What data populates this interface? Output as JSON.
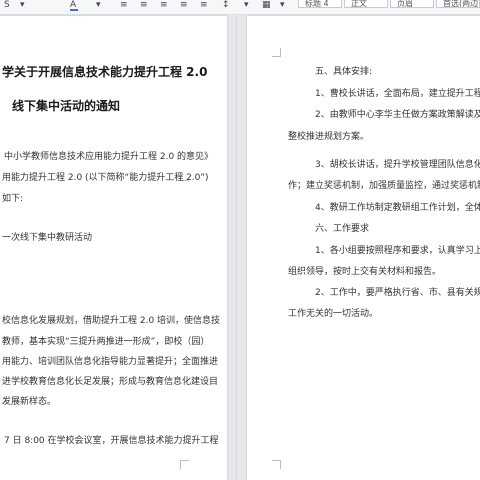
{
  "toolbar": {
    "style_box_1": "标题 4",
    "style_box_2": "正文",
    "style_box_3": "页眉",
    "style_box_4": "首选(两边)"
  },
  "left_page": {
    "title_line_1": "学关于开展信息技术能力提升工程 2.0",
    "title_line_2": "线下集中活动的通知",
    "line_1": "中小学教师信息技术应用能力提升工程 2.0 的意见》",
    "line_2": "用能力提升工程 2.0 (以下简称“能力提升工程 2.0”)",
    "line_3": "如下:",
    "line_4": "一次线下集中教研活动",
    "line_5": "校信息化发展规划，借助提升工程 2.0 培训，使信息技",
    "line_6": "教师，基本实现“三提升两推进一形成”，即校（园）",
    "line_7": "用能力、培训团队信息化指导能力显著提升；全面推进",
    "line_8": "进学校教育信息化长足发展；形成与教育信息化建设目",
    "line_9": "发展新样态。",
    "line_10": "7 日 8:00 在学校会议室，开展信息技术能力提升工程"
  },
  "right_page": {
    "line_1": "五、具体安排:",
    "line_2": "1、曹校长讲话，全面布局，建立提升工程长效",
    "line_3": "2、由教师中心李华主任做方案政策解读及能力",
    "line_4": "整校推进规划方案。",
    "line_5": "3、胡校长讲话，提升学校管理团队信息化领导力",
    "line_6": "作；建立奖惩机制，加强质量监控，通过奖惩机制，",
    "line_7": "4、教研工作坊制定教研组工作计划，全体教师",
    "line_8": "六、工作要求",
    "line_9": "1、各小组要按照程序和要求，认真学习上级文件",
    "line_10": "组织领导，按时上交有关材料和报告。",
    "line_11": "2、工作中，要严格执行省、市、县有关规定，严",
    "line_12": "工作无关的一切活动。"
  }
}
